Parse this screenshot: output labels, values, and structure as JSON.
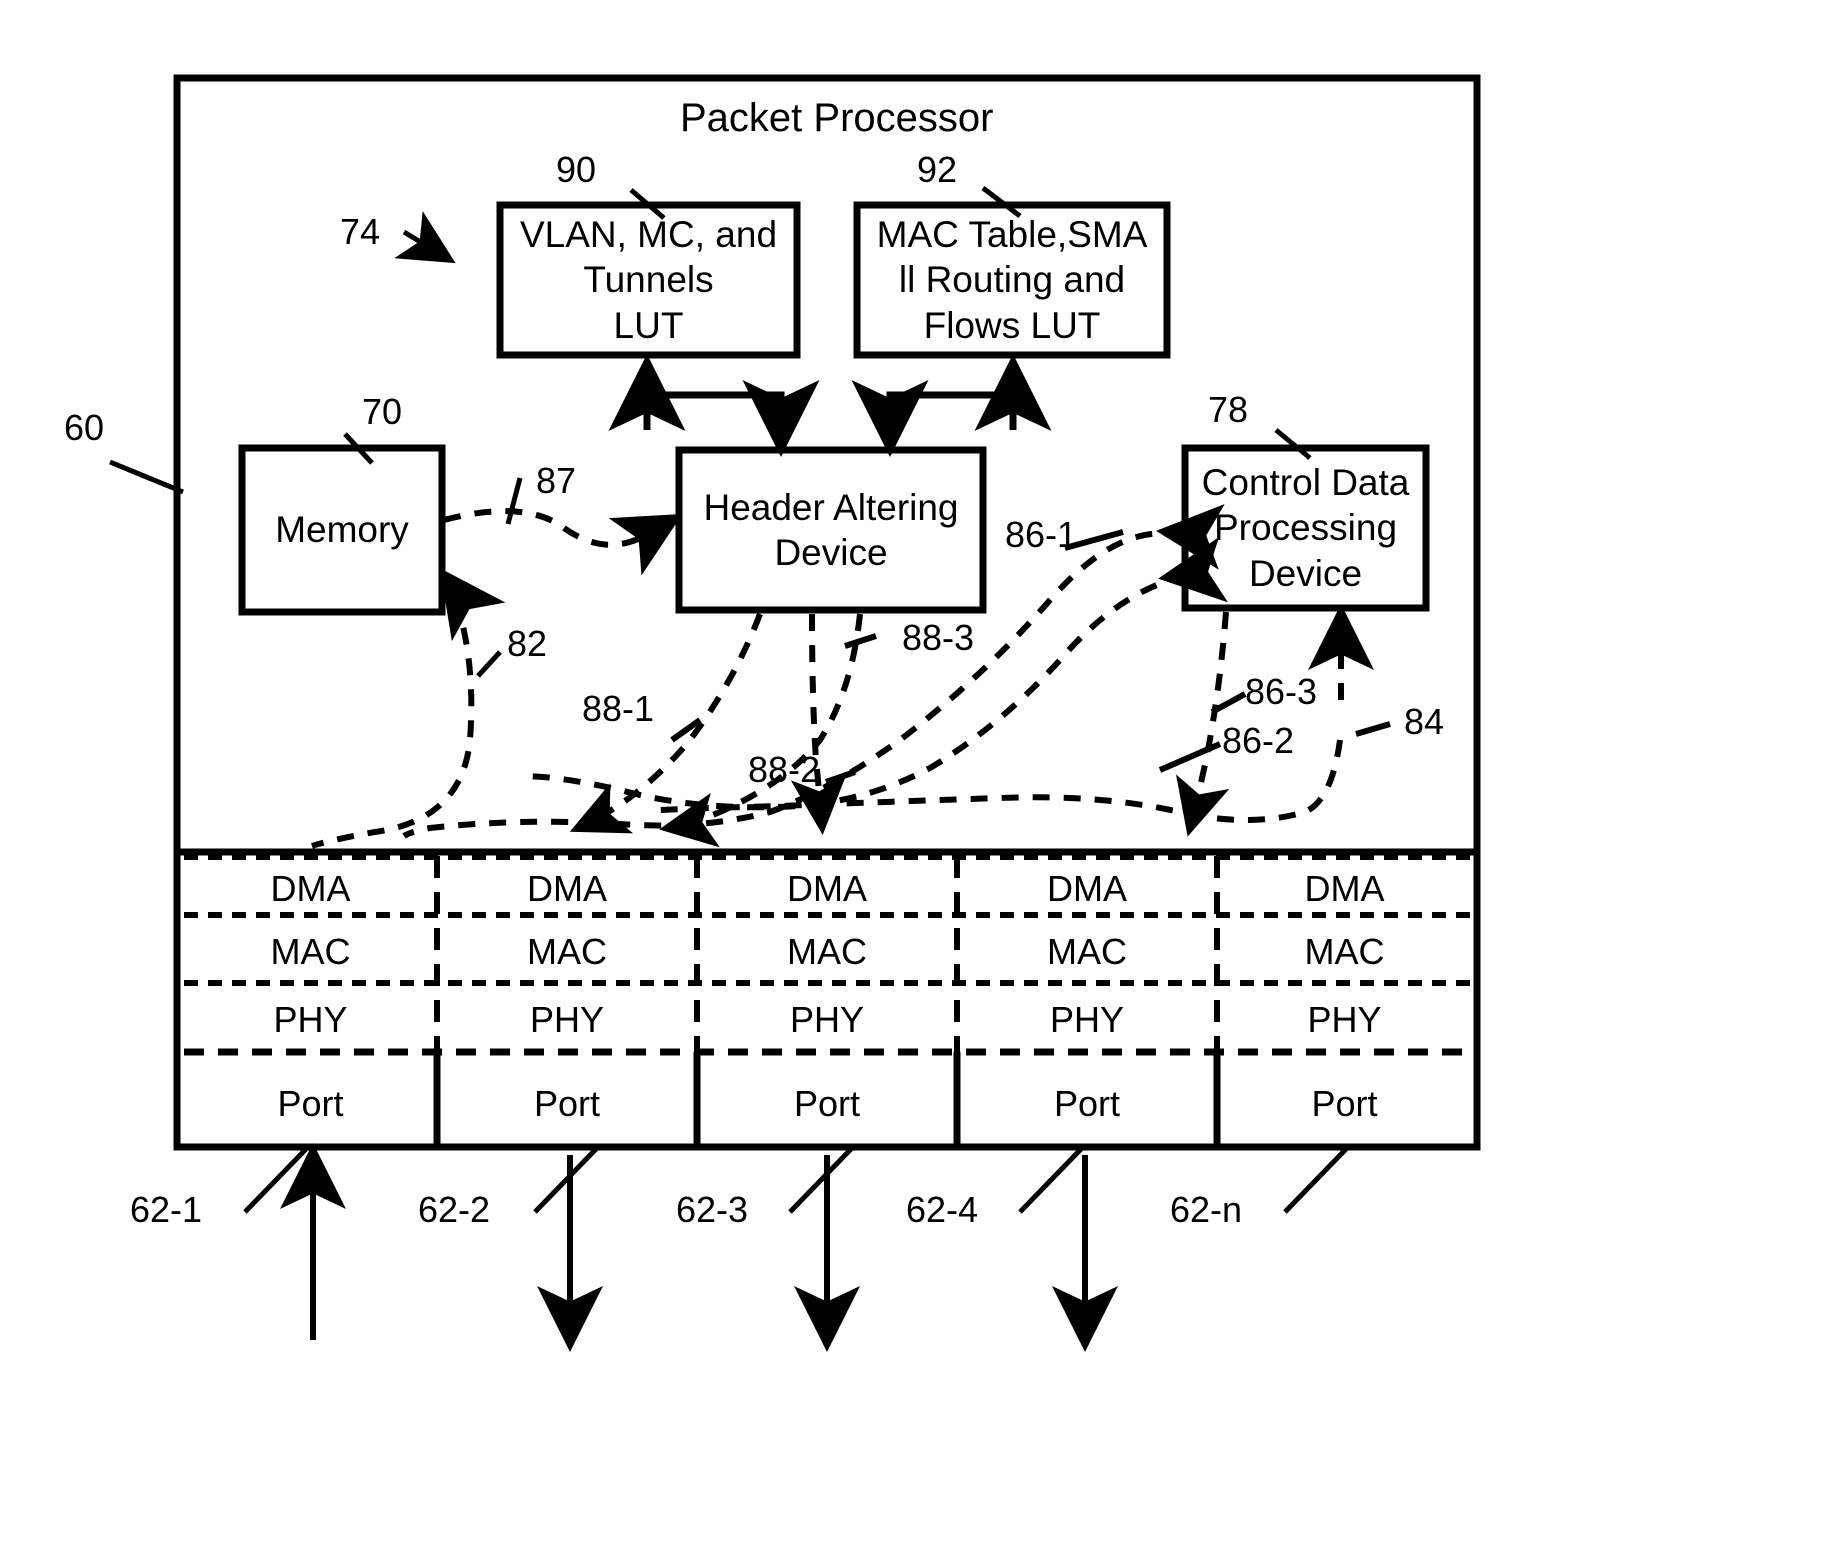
{
  "figure": {
    "outer_label": "60",
    "title": "Packet Processor",
    "pipeline_label": "74"
  },
  "blocks": {
    "lut_vlan": {
      "ref": "90",
      "lines": [
        "VLAN, MC, and",
        "Tunnels",
        "LUT"
      ],
      "text": "VLAN, MC, and Tunnels LUT"
    },
    "lut_mac": {
      "ref": "92",
      "lines": [
        "MAC Table,SMA",
        "ll Routing and",
        "Flows LUT"
      ],
      "text": "MAC Table,SMA ll Routing and Flows LUT"
    },
    "memory": {
      "ref": "70",
      "lines": [
        "Memory"
      ],
      "text": "Memory"
    },
    "header_altering": {
      "ref": "",
      "lines": [
        "Header Altering",
        "Device"
      ],
      "text": "Header Altering Device"
    },
    "control_data": {
      "ref": "78",
      "lines": [
        "Control Data",
        "Processing",
        "Device"
      ],
      "text": "Control Data Processing Device"
    }
  },
  "flow_labels": {
    "memory_to_header": "87",
    "to_memory": "82",
    "header_out_1": "88-1",
    "header_out_2": "88-2",
    "header_out_3": "88-3",
    "control_in_1": "86-1",
    "control_in_2": "86-2",
    "control_in_3": "86-3",
    "control_in_4": "84"
  },
  "port_stack": {
    "row_labels": [
      "DMA",
      "MAC",
      "PHY",
      "Port"
    ],
    "columns": [
      {
        "ref": "62-1",
        "rows": [
          "DMA",
          "MAC",
          "PHY",
          "Port"
        ],
        "direction": "in"
      },
      {
        "ref": "62-2",
        "rows": [
          "DMA",
          "MAC",
          "PHY",
          "Port"
        ],
        "direction": "out"
      },
      {
        "ref": "62-3",
        "rows": [
          "DMA",
          "MAC",
          "PHY",
          "Port"
        ],
        "direction": "out"
      },
      {
        "ref": "62-4",
        "rows": [
          "DMA",
          "MAC",
          "PHY",
          "Port"
        ],
        "direction": "out"
      },
      {
        "ref": "62-n",
        "rows": [
          "DMA",
          "MAC",
          "PHY",
          "Port"
        ],
        "direction": "none"
      }
    ]
  },
  "colors": {
    "ink": "#000000",
    "paper": "#ffffff"
  }
}
